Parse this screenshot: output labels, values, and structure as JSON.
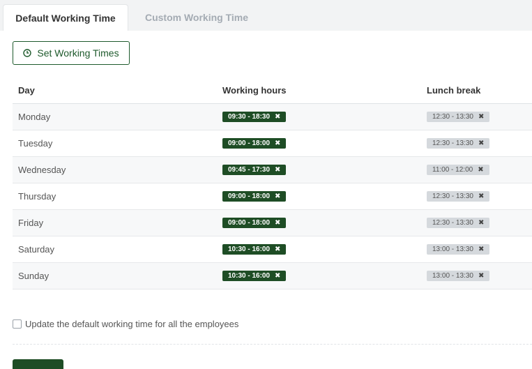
{
  "tabs": [
    {
      "label": "Default Working Time",
      "active": true
    },
    {
      "label": "Custom Working Time",
      "active": false
    }
  ],
  "set_button": {
    "label": "Set Working Times",
    "icon": "clock-icon"
  },
  "table": {
    "headers": {
      "day": "Day",
      "working_hours": "Working hours",
      "lunch_break": "Lunch break"
    },
    "rows": [
      {
        "day": "Monday",
        "working_hours": "09:30 - 18:30",
        "lunch_break": "12:30 - 13:30"
      },
      {
        "day": "Tuesday",
        "working_hours": "09:00 - 18:00",
        "lunch_break": "12:30 - 13:30"
      },
      {
        "day": "Wednesday",
        "working_hours": "09:45 - 17:30",
        "lunch_break": "11:00 - 12:00"
      },
      {
        "day": "Thursday",
        "working_hours": "09:00 - 18:00",
        "lunch_break": "12:30 - 13:30"
      },
      {
        "day": "Friday",
        "working_hours": "09:00 - 18:00",
        "lunch_break": "12:30 - 13:30"
      },
      {
        "day": "Saturday",
        "working_hours": "10:30 - 16:00",
        "lunch_break": "13:00 - 13:30"
      },
      {
        "day": "Sunday",
        "working_hours": "10:30 - 16:00",
        "lunch_break": "13:00 - 13:30"
      }
    ],
    "remove_glyph": "✖"
  },
  "update_checkbox": {
    "label": "Update the default working time for all the employees",
    "checked": false
  },
  "colors": {
    "accent": "#1e4d25",
    "lunch_pill": "#d5d9dd",
    "tab_inactive": "#a4abb3"
  }
}
